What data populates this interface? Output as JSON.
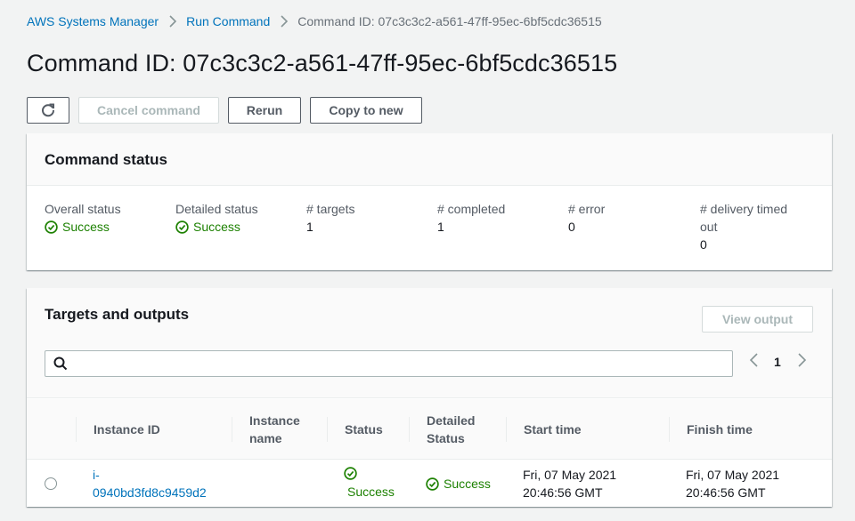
{
  "breadcrumb": {
    "root": "AWS Systems Manager",
    "section": "Run Command",
    "current": "Command ID: 07c3c3c2-a561-47ff-95ec-6bf5cdc36515"
  },
  "page_title": "Command ID: 07c3c3c2-a561-47ff-95ec-6bf5cdc36515",
  "toolbar": {
    "cancel_label": "Cancel command",
    "rerun_label": "Rerun",
    "copy_label": "Copy to new"
  },
  "command_status": {
    "title": "Command status",
    "overall_label": "Overall status",
    "overall_value": "Success",
    "detailed_label": "Detailed status",
    "detailed_value": "Success",
    "targets_label": "# targets",
    "targets_value": "1",
    "completed_label": "# completed",
    "completed_value": "1",
    "error_label": "# error",
    "error_value": "0",
    "timed_out_label_1": "# delivery timed",
    "timed_out_label_2": "out",
    "timed_out_value": "0"
  },
  "targets": {
    "title": "Targets and outputs",
    "view_output_label": "View output",
    "search_placeholder": "",
    "page": "1",
    "columns": {
      "instance_id": "Instance ID",
      "instance_name_1": "Instance",
      "instance_name_2": "name",
      "status": "Status",
      "detailed_status_1": "Detailed",
      "detailed_status_2": "Status",
      "start_time": "Start time",
      "finish_time": "Finish time"
    },
    "rows": [
      {
        "instance_id_1": "i-",
        "instance_id_2": "0940bd3fd8c9459d2",
        "instance_name": "",
        "status": "Success",
        "detailed_status": "Success",
        "start_time_1": "Fri, 07 May 2021",
        "start_time_2": "20:46:56 GMT",
        "finish_time_1": "Fri, 07 May 2021",
        "finish_time_2": "20:46:56 GMT"
      }
    ]
  },
  "colors": {
    "link": "#0073bb",
    "success": "#1d8102",
    "text": "#16191f",
    "secondary_text": "#545b64",
    "disabled": "#aab7b8"
  }
}
